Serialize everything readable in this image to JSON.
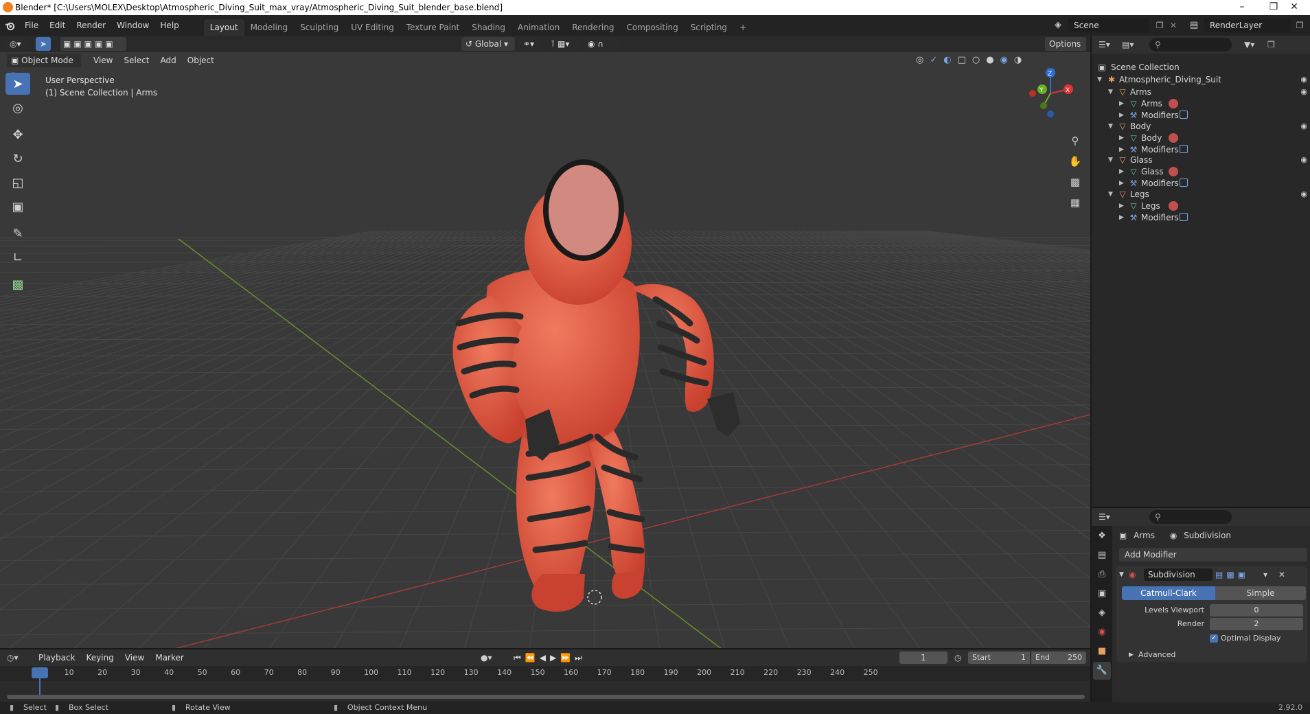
{
  "window": {
    "title": "Blender* [C:\\Users\\MOLEX\\Desktop\\Atmospheric_Diving_Suit_max_vray/Atmospheric_Diving_Suit_blender_base.blend]",
    "minimize": "–",
    "maximize": "❐",
    "close": "✕"
  },
  "menu": {
    "items": [
      "File",
      "Edit",
      "Render",
      "Window",
      "Help"
    ]
  },
  "workspaces": {
    "tabs": [
      "Layout",
      "Modeling",
      "Sculpting",
      "UV Editing",
      "Texture Paint",
      "Shading",
      "Animation",
      "Rendering",
      "Compositing",
      "Scripting"
    ],
    "active": "Layout",
    "add": "+"
  },
  "scene": {
    "name": "Scene",
    "render_layer": "RenderLayer"
  },
  "viewport_header": {
    "mode": "Object Mode",
    "menus": [
      "View",
      "Select",
      "Add",
      "Object"
    ],
    "transform_orientation": "Global",
    "options": "Options"
  },
  "viewport": {
    "perspective": "User Perspective",
    "collection_info": "(1) Scene Collection | Arms",
    "gizmo": {
      "x": "X",
      "y": "Y",
      "z": "Z"
    },
    "colors": {
      "bg": "#393939",
      "suit": "#e0533d",
      "band": "#2a2a2a",
      "x_axis": "#a33a3a",
      "y_axis": "#6b8f2a"
    }
  },
  "outliner": {
    "root": "Scene Collection",
    "collection": "Atmospheric_Diving_Suit",
    "objects": [
      {
        "name": "Arms",
        "mesh": "Arms",
        "modifiers": "Modifiers"
      },
      {
        "name": "Body",
        "mesh": "Body",
        "modifiers": "Modifiers"
      },
      {
        "name": "Glass",
        "mesh": "Glass",
        "modifiers": "Modifiers"
      },
      {
        "name": "Legs",
        "mesh": "Legs",
        "modifiers": "Modifiers"
      }
    ]
  },
  "properties": {
    "object": "Arms",
    "modifier_context": "Subdivision",
    "add_modifier": "Add Modifier",
    "modifier": {
      "name": "Subdivision",
      "type_a": "Catmull-Clark",
      "type_b": "Simple",
      "active_type": "Catmull-Clark",
      "levels_viewport_label": "Levels Viewport",
      "levels_viewport": "0",
      "render_label": "Render",
      "render": "2",
      "optimal_display": "Optimal Display",
      "advanced": "Advanced"
    }
  },
  "timeline": {
    "menus": [
      "Playback",
      "Keying",
      "View",
      "Marker"
    ],
    "current_frame": "1",
    "start_label": "Start",
    "start": "1",
    "end_label": "End",
    "end": "250",
    "ticks": [
      "1",
      "10",
      "20",
      "30",
      "40",
      "50",
      "60",
      "70",
      "80",
      "90",
      "100",
      "110",
      "120",
      "130",
      "140",
      "150",
      "160",
      "170",
      "180",
      "190",
      "200",
      "210",
      "220",
      "230",
      "240",
      "250"
    ]
  },
  "status": {
    "select": "Select",
    "box_select": "Box Select",
    "rotate_view": "Rotate View",
    "context_menu": "Object Context Menu",
    "version": "2.92.0"
  }
}
